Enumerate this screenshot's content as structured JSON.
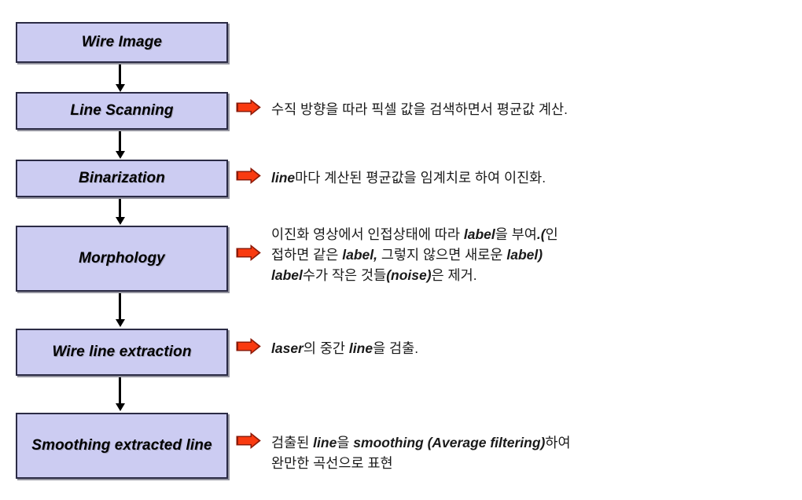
{
  "diagram": {
    "title": "Wire line extraction processing flow",
    "box_fill_color": "#ccccf2",
    "box_border_color": "#2b2b45",
    "arrow_icon_color": "#f93a10",
    "arrow_icon_shadow_color": "#8c1a08",
    "steps": [
      {
        "id": "wire-image",
        "label": "Wire Image"
      },
      {
        "id": "line-scanning",
        "label": "Line Scanning"
      },
      {
        "id": "binarization",
        "label": "Binarization"
      },
      {
        "id": "morphology",
        "label": "Morphology"
      },
      {
        "id": "wire-line-extraction",
        "label": "Wire line extraction"
      },
      {
        "id": "smoothing-extracted-line",
        "label": "Smoothing\nextracted line"
      }
    ],
    "annotations": [
      {
        "id": "line-scanning-note",
        "icon": "right-block-arrow-icon",
        "text": "수직 방향을 따라 픽셀 값을 검색하면서 평균값 계산.",
        "html": "수직 방향을 따라 픽셀 값을 검색하면서 평균값 계산."
      },
      {
        "id": "binarization-note",
        "icon": "right-block-arrow-icon",
        "text": "line마다 계산된 평균값을 임계치로 하여 이진화.",
        "html": "<b>line</b>마다 계산된 평균값을 임계치로 하여 이진화."
      },
      {
        "id": "morphology-note",
        "icon": "right-block-arrow-icon",
        "text": "이진화 영상에서 인접상태에 따라 label을 부여.(인\n접하면 같은 label, 그렇지 않으면 새로운 label)\nlabel수가 작은 것들(noise)은 제거.",
        "html": "이진화 영상에서 인접상태에 따라 <b>label</b>을 부여<b>.(</b>인\n접하면 같은 <b>label,</b> 그렇지 않으면 새로운 <b>label)</b>\n<b>label</b>수가 작은 것들<b>(noise)</b>은 제거."
      },
      {
        "id": "wire-line-extraction-note",
        "icon": "right-block-arrow-icon",
        "text": "laser의 중간 line을 검출.",
        "html": "<b>laser</b>의 중간 <b>line</b>을 검출."
      },
      {
        "id": "smoothing-note",
        "icon": "right-block-arrow-icon",
        "text": "검출된 line을 smoothing (Average filtering)하여\n완만한 곡선으로 표현",
        "html": "검출된 <b>line</b>을 <b>smoothing (Average filtering)</b>하여\n완만한 곡선으로 표현"
      }
    ]
  }
}
